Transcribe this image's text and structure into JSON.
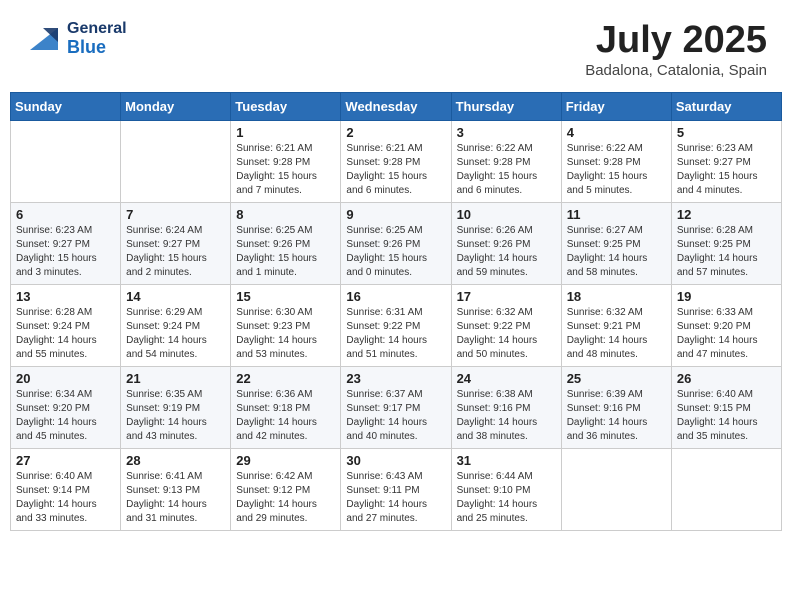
{
  "header": {
    "logo_general": "General",
    "logo_blue": "Blue",
    "month_title": "July 2025",
    "location": "Badalona, Catalonia, Spain"
  },
  "weekdays": [
    "Sunday",
    "Monday",
    "Tuesday",
    "Wednesday",
    "Thursday",
    "Friday",
    "Saturday"
  ],
  "weeks": [
    [
      {
        "day": "",
        "content": ""
      },
      {
        "day": "",
        "content": ""
      },
      {
        "day": "1",
        "content": "Sunrise: 6:21 AM\nSunset: 9:28 PM\nDaylight: 15 hours and 7 minutes."
      },
      {
        "day": "2",
        "content": "Sunrise: 6:21 AM\nSunset: 9:28 PM\nDaylight: 15 hours and 6 minutes."
      },
      {
        "day": "3",
        "content": "Sunrise: 6:22 AM\nSunset: 9:28 PM\nDaylight: 15 hours and 6 minutes."
      },
      {
        "day": "4",
        "content": "Sunrise: 6:22 AM\nSunset: 9:28 PM\nDaylight: 15 hours and 5 minutes."
      },
      {
        "day": "5",
        "content": "Sunrise: 6:23 AM\nSunset: 9:27 PM\nDaylight: 15 hours and 4 minutes."
      }
    ],
    [
      {
        "day": "6",
        "content": "Sunrise: 6:23 AM\nSunset: 9:27 PM\nDaylight: 15 hours and 3 minutes."
      },
      {
        "day": "7",
        "content": "Sunrise: 6:24 AM\nSunset: 9:27 PM\nDaylight: 15 hours and 2 minutes."
      },
      {
        "day": "8",
        "content": "Sunrise: 6:25 AM\nSunset: 9:26 PM\nDaylight: 15 hours and 1 minute."
      },
      {
        "day": "9",
        "content": "Sunrise: 6:25 AM\nSunset: 9:26 PM\nDaylight: 15 hours and 0 minutes."
      },
      {
        "day": "10",
        "content": "Sunrise: 6:26 AM\nSunset: 9:26 PM\nDaylight: 14 hours and 59 minutes."
      },
      {
        "day": "11",
        "content": "Sunrise: 6:27 AM\nSunset: 9:25 PM\nDaylight: 14 hours and 58 minutes."
      },
      {
        "day": "12",
        "content": "Sunrise: 6:28 AM\nSunset: 9:25 PM\nDaylight: 14 hours and 57 minutes."
      }
    ],
    [
      {
        "day": "13",
        "content": "Sunrise: 6:28 AM\nSunset: 9:24 PM\nDaylight: 14 hours and 55 minutes."
      },
      {
        "day": "14",
        "content": "Sunrise: 6:29 AM\nSunset: 9:24 PM\nDaylight: 14 hours and 54 minutes."
      },
      {
        "day": "15",
        "content": "Sunrise: 6:30 AM\nSunset: 9:23 PM\nDaylight: 14 hours and 53 minutes."
      },
      {
        "day": "16",
        "content": "Sunrise: 6:31 AM\nSunset: 9:22 PM\nDaylight: 14 hours and 51 minutes."
      },
      {
        "day": "17",
        "content": "Sunrise: 6:32 AM\nSunset: 9:22 PM\nDaylight: 14 hours and 50 minutes."
      },
      {
        "day": "18",
        "content": "Sunrise: 6:32 AM\nSunset: 9:21 PM\nDaylight: 14 hours and 48 minutes."
      },
      {
        "day": "19",
        "content": "Sunrise: 6:33 AM\nSunset: 9:20 PM\nDaylight: 14 hours and 47 minutes."
      }
    ],
    [
      {
        "day": "20",
        "content": "Sunrise: 6:34 AM\nSunset: 9:20 PM\nDaylight: 14 hours and 45 minutes."
      },
      {
        "day": "21",
        "content": "Sunrise: 6:35 AM\nSunset: 9:19 PM\nDaylight: 14 hours and 43 minutes."
      },
      {
        "day": "22",
        "content": "Sunrise: 6:36 AM\nSunset: 9:18 PM\nDaylight: 14 hours and 42 minutes."
      },
      {
        "day": "23",
        "content": "Sunrise: 6:37 AM\nSunset: 9:17 PM\nDaylight: 14 hours and 40 minutes."
      },
      {
        "day": "24",
        "content": "Sunrise: 6:38 AM\nSunset: 9:16 PM\nDaylight: 14 hours and 38 minutes."
      },
      {
        "day": "25",
        "content": "Sunrise: 6:39 AM\nSunset: 9:16 PM\nDaylight: 14 hours and 36 minutes."
      },
      {
        "day": "26",
        "content": "Sunrise: 6:40 AM\nSunset: 9:15 PM\nDaylight: 14 hours and 35 minutes."
      }
    ],
    [
      {
        "day": "27",
        "content": "Sunrise: 6:40 AM\nSunset: 9:14 PM\nDaylight: 14 hours and 33 minutes."
      },
      {
        "day": "28",
        "content": "Sunrise: 6:41 AM\nSunset: 9:13 PM\nDaylight: 14 hours and 31 minutes."
      },
      {
        "day": "29",
        "content": "Sunrise: 6:42 AM\nSunset: 9:12 PM\nDaylight: 14 hours and 29 minutes."
      },
      {
        "day": "30",
        "content": "Sunrise: 6:43 AM\nSunset: 9:11 PM\nDaylight: 14 hours and 27 minutes."
      },
      {
        "day": "31",
        "content": "Sunrise: 6:44 AM\nSunset: 9:10 PM\nDaylight: 14 hours and 25 minutes."
      },
      {
        "day": "",
        "content": ""
      },
      {
        "day": "",
        "content": ""
      }
    ]
  ]
}
